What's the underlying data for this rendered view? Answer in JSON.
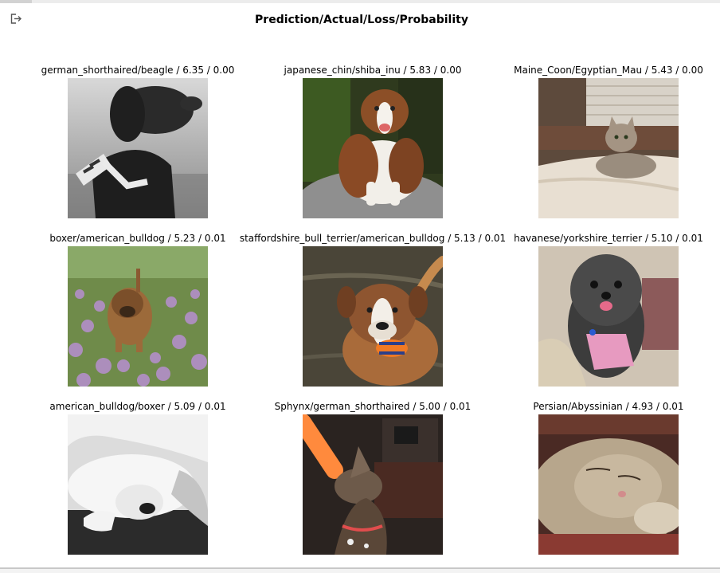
{
  "figure": {
    "title": "Prediction/Actual/Loss/Probability"
  },
  "toolbar": {
    "export_icon": "export-icon"
  },
  "grid": [
    {
      "caption": "german_shorthaired/beagle / 6.35 / 0.00",
      "subject": "black dog with scarf"
    },
    {
      "caption": "japanese_chin/shiba_inu / 5.83 / 0.00",
      "subject": "australian shepherd on rock"
    },
    {
      "caption": "Maine_Coon/Egyptian_Mau / 5.43 / 0.00",
      "subject": "tabby cat on bed"
    },
    {
      "caption": "boxer/american_bulldog / 5.23 / 0.01",
      "subject": "bulldog in flower field"
    },
    {
      "caption": "staffordshire_bull_terrier/american_bulldog / 5.13 / 0.01",
      "subject": "dog with toy in water"
    },
    {
      "caption": "havanese/yorkshire_terrier / 5.10 / 0.01",
      "subject": "fluffy grey dog in pink"
    },
    {
      "caption": "american_bulldog/boxer / 5.09 / 0.01",
      "subject": "sleeping white dog"
    },
    {
      "caption": "Sphynx/german_shorthaired / 5.00 / 0.01",
      "subject": "dog biting orange noodle"
    },
    {
      "caption": "Persian/Abyssinian / 4.93 / 0.01",
      "subject": "sleeping cat"
    }
  ]
}
